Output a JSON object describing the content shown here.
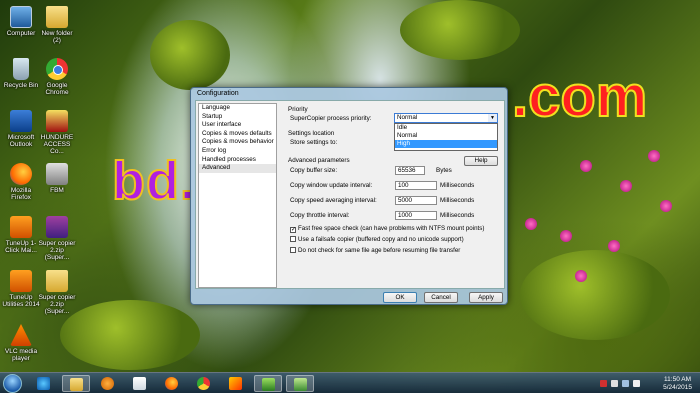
{
  "desktop": {
    "icons": [
      {
        "label": "Computer"
      },
      {
        "label": "New folder (2)"
      },
      {
        "label": "Recycle Bin"
      },
      {
        "label": "Google Chrome"
      },
      {
        "label": "Microsoft Outlook"
      },
      {
        "label": "HUNDURE ACCESS Co..."
      },
      {
        "label": "Mozilla Firefox"
      },
      {
        "label": "FBM"
      },
      {
        "label": "TuneUp 1-Click Mai..."
      },
      {
        "label": "Super copier 2.zip (Super..."
      },
      {
        "label": "TuneUp Utilities 2014"
      },
      {
        "label": "Super copier 2.zip (Super..."
      },
      {
        "label": "VLC media player"
      }
    ],
    "watermark_left": "bd.t",
    "watermark_right": ".com"
  },
  "dialog": {
    "title": "Configuration",
    "nav": [
      "Language",
      "Startup",
      "User interface",
      "Copies & moves defaults",
      "Copies & moves behavior",
      "Error log",
      "Handled processes",
      "Advanced"
    ],
    "selected_nav": "Advanced",
    "priority": {
      "section": "Priority",
      "label": "SuperCopier process priority:",
      "value": "Normal",
      "options": [
        "Idle",
        "Normal",
        "High"
      ]
    },
    "settings_location": {
      "section": "Settings location",
      "label": "Store settings to:"
    },
    "advanced": {
      "section": "Advanced parameters",
      "help_label": "Help",
      "rows": [
        {
          "label": "Copy buffer size:",
          "value": "65536",
          "unit": "Bytes"
        },
        {
          "label": "Copy window update interval:",
          "value": "100",
          "unit": "Milliseconds"
        },
        {
          "label": "Copy speed averaging interval:",
          "value": "5000",
          "unit": "Milliseconds"
        },
        {
          "label": "Copy throttle interval:",
          "value": "1000",
          "unit": "Milliseconds"
        }
      ],
      "checks": [
        {
          "label": "Fast free space check (can have problems with NTFS mount points)",
          "checked": true
        },
        {
          "label": "Use a failsafe copier (buffered copy and no unicode support)",
          "checked": false
        },
        {
          "label": "Do not check for same file age before resuming file transfer",
          "checked": false
        }
      ]
    },
    "buttons": {
      "ok": "OK",
      "cancel": "Cancel",
      "apply": "Apply"
    }
  },
  "taskbar": {
    "time": "11:50 AM",
    "date": "5/24/2015"
  }
}
